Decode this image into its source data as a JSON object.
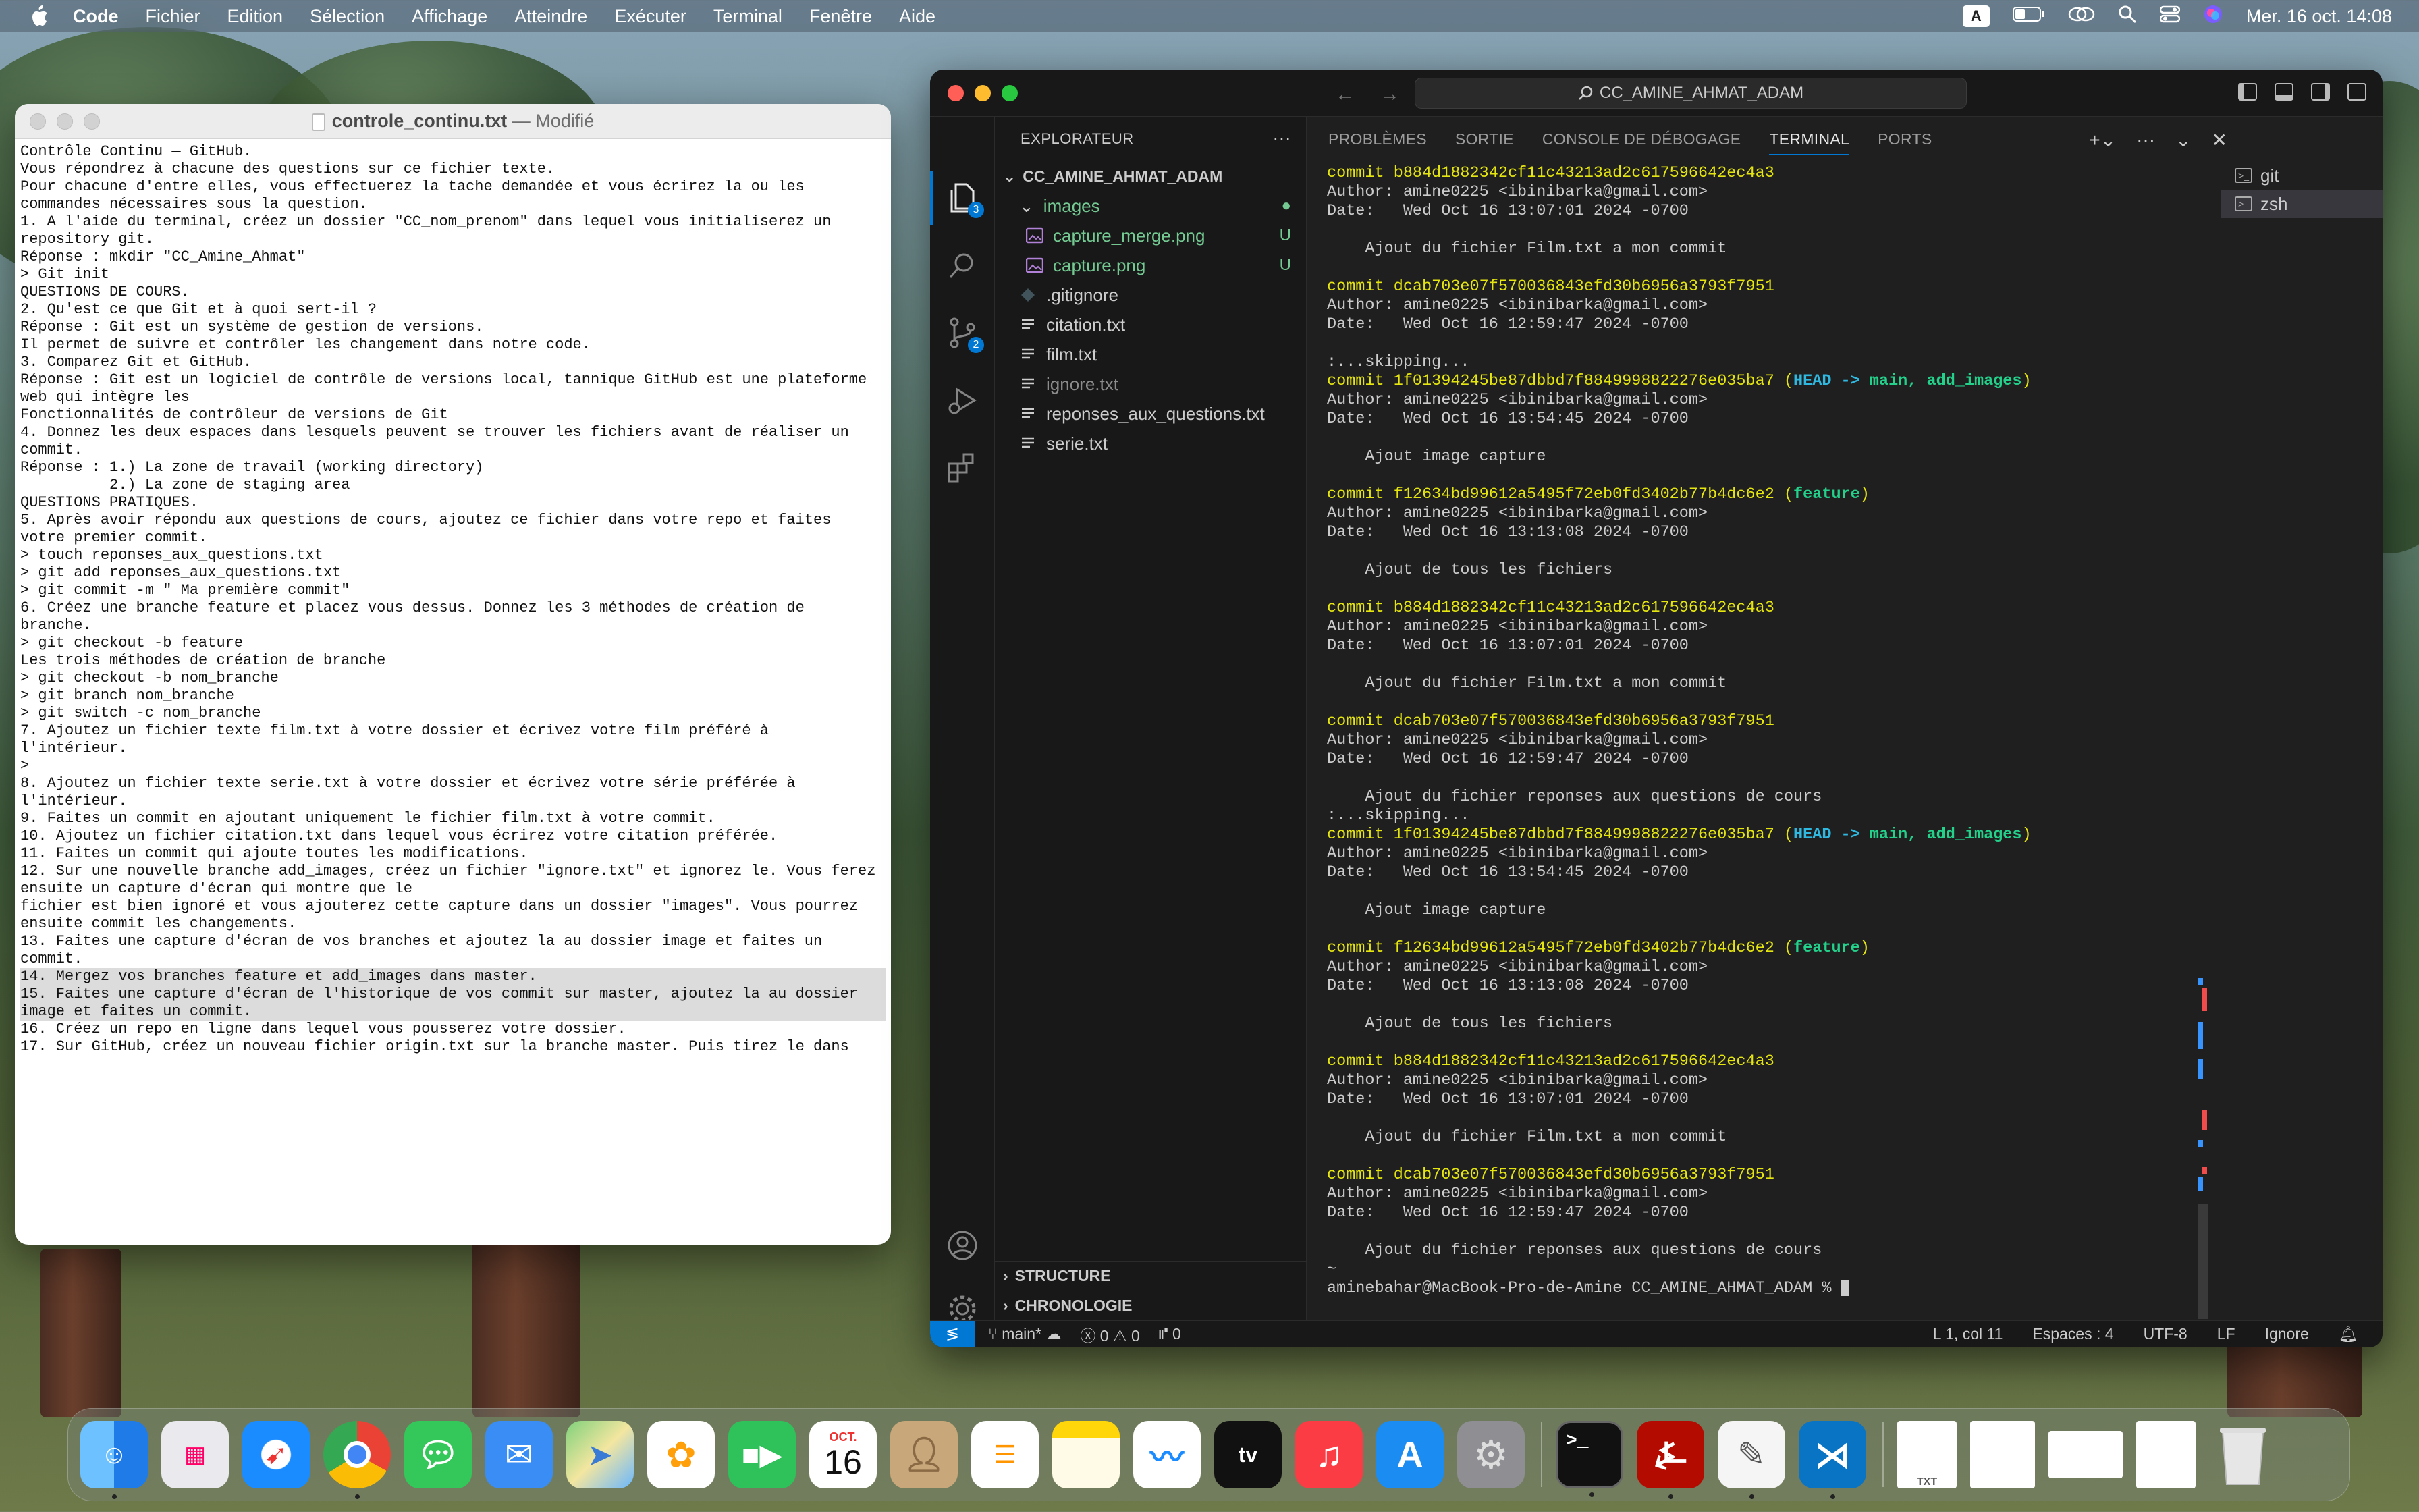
{
  "menubar": {
    "app": "Code",
    "items": [
      "Fichier",
      "Edition",
      "Sélection",
      "Affichage",
      "Atteindre",
      "Exécuter",
      "Terminal",
      "Fenêtre",
      "Aide"
    ],
    "input_badge": "A",
    "datetime": "Mer. 16 oct.  14:08"
  },
  "textedit": {
    "filename": "controle_continu.txt",
    "modified": "— Modifié",
    "lines": [
      "Contrôle Continu — GitHub.",
      "",
      "Vous répondrez à chacune des questions sur ce fichier texte.",
      "Pour chacune d'entre elles, vous effectuerez la tache demandée et vous écrirez la ou les",
      "commandes nécessaires sous la question.",
      "",
      "1. A l'aide du terminal, créez un dossier \"CC_nom_prenom\" dans lequel vous initialiserez un",
      "repository git.",
      "",
      "Réponse : mkdir \"CC_Amine_Ahmat\"",
      "> Git init",
      "",
      "QUESTIONS DE COURS.",
      "2. Qu'est ce que Git et à quoi sert-il ?",
      "Réponse : Git est un système de gestion de versions.",
      "Il permet de suivre et contrôler les changement dans notre code.",
      "",
      "3. Comparez Git et GitHub.",
      "Réponse : Git est un logiciel de contrôle de versions local, tannique GitHub est une plateforme",
      "web qui intègre les",
      "Fonctionnalités de contrôleur de versions de Git",
      "",
      "4. Donnez les deux espaces dans lesquels peuvent se trouver les fichiers avant de réaliser un",
      "commit.",
      "Réponse : 1.) La zone de travail (working directory)",
      "          2.) La zone de staging area",
      "",
      "QUESTIONS PRATIQUES.",
      "",
      "5. Après avoir répondu aux questions de cours, ajoutez ce fichier dans votre repo et faites",
      "votre premier commit.",
      "> touch reponses_aux_questions.txt",
      "> git add reponses_aux_questions.txt",
      "> git commit -m \" Ma première commit\"",
      "",
      "6. Créez une branche feature et placez vous dessus. Donnez les 3 méthodes de création de",
      "branche.",
      "> git checkout -b feature",
      "",
      "Les trois méthodes de création de branche",
      "> git checkout -b nom_branche",
      "> git branch nom_branche",
      "> git switch -c nom_branche",
      "",
      "7. Ajoutez un fichier texte film.txt à votre dossier et écrivez votre film préféré à",
      "l'intérieur.",
      ">",
      "8. Ajoutez un fichier texte serie.txt à votre dossier et écrivez votre série préférée à",
      "l'intérieur.",
      "9. Faites un commit en ajoutant uniquement le fichier film.txt à votre commit.",
      "10. Ajoutez un fichier citation.txt dans lequel vous écrirez votre citation préférée.",
      "11. Faites un commit qui ajoute toutes les modifications.",
      "12. Sur une nouvelle branche add_images, créez un fichier \"ignore.txt\" et ignorez le. Vous ferez",
      "ensuite un capture d'écran qui montre que le",
      "fichier est bien ignoré et vous ajouterez cette capture dans un dossier \"images\". Vous pourrez",
      "ensuite commit les changements.",
      "13. Faites une capture d'écran de vos branches et ajoutez la au dossier image et faites un",
      "commit.",
      "14. Mergez vos branches feature et add_images dans master.",
      "15. Faites une capture d'écran de l'historique de vos commit sur master, ajoutez la au dossier",
      "image et faites un commit.",
      "16. Créez un repo en ligne dans lequel vous pousserez votre dossier.",
      "17. Sur GitHub, créez un nouveau fichier origin.txt sur la branche master. Puis tirez le dans"
    ]
  },
  "vscode": {
    "search": "CC_AMINE_AHMAT_ADAM",
    "explorer_title": "EXPLORATEUR",
    "project": "CC_AMINE_AHMAT_ADAM",
    "explorer_badge": "3",
    "scm_badge": "2",
    "files": [
      {
        "name": "images",
        "kind": "folder",
        "status": "●",
        "cls": "untracked",
        "indent": 1
      },
      {
        "name": "capture_merge.png",
        "kind": "image",
        "status": "U",
        "cls": "untracked",
        "indent": 2
      },
      {
        "name": "capture.png",
        "kind": "image",
        "status": "U",
        "cls": "untracked",
        "indent": 2
      },
      {
        "name": ".gitignore",
        "kind": "git",
        "status": "",
        "cls": "",
        "indent": 1
      },
      {
        "name": "citation.txt",
        "kind": "text",
        "status": "",
        "cls": "",
        "indent": 1
      },
      {
        "name": "film.txt",
        "kind": "text",
        "status": "",
        "cls": "",
        "indent": 1
      },
      {
        "name": "ignore.txt",
        "kind": "text",
        "status": "",
        "cls": "ignored",
        "indent": 1
      },
      {
        "name": "reponses_aux_questions.txt",
        "kind": "text",
        "status": "",
        "cls": "",
        "indent": 1
      },
      {
        "name": "serie.txt",
        "kind": "text",
        "status": "",
        "cls": "",
        "indent": 1
      }
    ],
    "outline": "STRUCTURE",
    "timeline": "CHRONOLOGIE",
    "panel_tabs": [
      "PROBLÈMES",
      "SORTIE",
      "CONSOLE DE DÉBOGAGE",
      "TERMINAL",
      "PORTS"
    ],
    "terminals": [
      "git",
      "zsh"
    ],
    "prompt": "aminebahar@MacBook-Pro-de-Amine CC_AMINE_AHMAT_ADAM % ",
    "status": {
      "branch": "main*",
      "errors": "0",
      "warnings": "0",
      "ports": "0",
      "position": "L 1, col 11",
      "spaces": "Espaces : 4",
      "encoding": "UTF-8",
      "eol": "LF",
      "language": "Ignore"
    }
  },
  "terminal_lines": [
    {
      "t": "commit",
      "hash": "b884d1882342cf11c43213ad2c617596642ec4a3"
    },
    {
      "t": "plain",
      "text": "Author: amine0225 <ibinibarka@gmail.com>"
    },
    {
      "t": "plain",
      "text": "Date:   Wed Oct 16 13:07:01 2024 -0700"
    },
    {
      "t": "plain",
      "text": ""
    },
    {
      "t": "plain",
      "text": "    Ajout du fichier Film.txt a mon commit"
    },
    {
      "t": "plain",
      "text": ""
    },
    {
      "t": "commit",
      "hash": "dcab703e07f570036843efd30b6956a3793f7951"
    },
    {
      "t": "plain",
      "text": "Author: amine0225 <ibinibarka@gmail.com>"
    },
    {
      "t": "plain",
      "text": "Date:   Wed Oct 16 12:59:47 2024 -0700"
    },
    {
      "t": "plain",
      "text": ""
    },
    {
      "t": "plain",
      "text": ":...skipping..."
    },
    {
      "t": "commit",
      "hash": "1f01394245be87dbbd7f8849998822276e035ba7",
      "refs": "head"
    },
    {
      "t": "plain",
      "text": "Author: amine0225 <ibinibarka@gmail.com>"
    },
    {
      "t": "plain",
      "text": "Date:   Wed Oct 16 13:54:45 2024 -0700"
    },
    {
      "t": "plain",
      "text": ""
    },
    {
      "t": "plain",
      "text": "    Ajout image capture"
    },
    {
      "t": "plain",
      "text": ""
    },
    {
      "t": "commit",
      "hash": "f12634bd99612a5495f72eb0fd3402b77b4dc6e2",
      "refs": "feature"
    },
    {
      "t": "plain",
      "text": "Author: amine0225 <ibinibarka@gmail.com>"
    },
    {
      "t": "plain",
      "text": "Date:   Wed Oct 16 13:13:08 2024 -0700"
    },
    {
      "t": "plain",
      "text": ""
    },
    {
      "t": "plain",
      "text": "    Ajout de tous les fichiers"
    },
    {
      "t": "plain",
      "text": ""
    },
    {
      "t": "commit",
      "hash": "b884d1882342cf11c43213ad2c617596642ec4a3"
    },
    {
      "t": "plain",
      "text": "Author: amine0225 <ibinibarka@gmail.com>"
    },
    {
      "t": "plain",
      "text": "Date:   Wed Oct 16 13:07:01 2024 -0700"
    },
    {
      "t": "plain",
      "text": ""
    },
    {
      "t": "plain",
      "text": "    Ajout du fichier Film.txt a mon commit"
    },
    {
      "t": "plain",
      "text": ""
    },
    {
      "t": "commit",
      "hash": "dcab703e07f570036843efd30b6956a3793f7951"
    },
    {
      "t": "plain",
      "text": "Author: amine0225 <ibinibarka@gmail.com>"
    },
    {
      "t": "plain",
      "text": "Date:   Wed Oct 16 12:59:47 2024 -0700"
    },
    {
      "t": "plain",
      "text": ""
    },
    {
      "t": "plain",
      "text": "    Ajout du fichier reponses aux questions de cours"
    },
    {
      "t": "plain",
      "text": ":...skipping..."
    },
    {
      "t": "commit",
      "hash": "1f01394245be87dbbd7f8849998822276e035ba7",
      "refs": "head"
    },
    {
      "t": "plain",
      "text": "Author: amine0225 <ibinibarka@gmail.com>"
    },
    {
      "t": "plain",
      "text": "Date:   Wed Oct 16 13:54:45 2024 -0700"
    },
    {
      "t": "plain",
      "text": ""
    },
    {
      "t": "plain",
      "text": "    Ajout image capture"
    },
    {
      "t": "plain",
      "text": ""
    },
    {
      "t": "commit",
      "hash": "f12634bd99612a5495f72eb0fd3402b77b4dc6e2",
      "refs": "feature"
    },
    {
      "t": "plain",
      "text": "Author: amine0225 <ibinibarka@gmail.com>"
    },
    {
      "t": "plain",
      "text": "Date:   Wed Oct 16 13:13:08 2024 -0700"
    },
    {
      "t": "plain",
      "text": ""
    },
    {
      "t": "plain",
      "text": "    Ajout de tous les fichiers"
    },
    {
      "t": "plain",
      "text": ""
    },
    {
      "t": "commit",
      "hash": "b884d1882342cf11c43213ad2c617596642ec4a3"
    },
    {
      "t": "plain",
      "text": "Author: amine0225 <ibinibarka@gmail.com>"
    },
    {
      "t": "plain",
      "text": "Date:   Wed Oct 16 13:07:01 2024 -0700"
    },
    {
      "t": "plain",
      "text": ""
    },
    {
      "t": "plain",
      "text": "    Ajout du fichier Film.txt a mon commit"
    },
    {
      "t": "plain",
      "text": ""
    },
    {
      "t": "commit",
      "hash": "dcab703e07f570036843efd30b6956a3793f7951"
    },
    {
      "t": "plain",
      "text": "Author: amine0225 <ibinibarka@gmail.com>"
    },
    {
      "t": "plain",
      "text": "Date:   Wed Oct 16 12:59:47 2024 -0700"
    },
    {
      "t": "plain",
      "text": ""
    },
    {
      "t": "plain",
      "text": "    Ajout du fichier reponses aux questions de cours"
    },
    {
      "t": "plain",
      "text": "~"
    }
  ],
  "head_refs": {
    "head": "HEAD",
    "arrow": " -> ",
    "branches": "main, add_images"
  },
  "feature_ref": "feature",
  "dock": {
    "calendar_month": "OCT.",
    "calendar_day": "16",
    "apps": [
      "finder",
      "launchpad",
      "safari",
      "chrome",
      "messages",
      "mail",
      "maps",
      "photos",
      "facetime",
      "calendar",
      "contacts",
      "reminders",
      "notes",
      "freeform",
      "tv",
      "music",
      "app-store",
      "settings",
      "terminal",
      "acrobat",
      "textedit",
      "vscode",
      "recent-doc-1",
      "recent-doc-2",
      "recent-doc-3",
      "recent-doc-4",
      "trash"
    ],
    "colors": {
      "finder": "#1e90ff",
      "safari": "#1a8cff",
      "messages": "#34c759",
      "mail": "#3a8df5",
      "facetime": "#2fc15a",
      "music": "#fc3c44",
      "appstore": "#1b8cf2",
      "acrobat": "#b30b00",
      "vscode": "#0a74c4"
    }
  },
  "colors": {
    "accent": "#0078d4",
    "commit_yellow": "#e5e510",
    "branch_green": "#23d18b",
    "head_cyan": "#2fb8e0"
  }
}
